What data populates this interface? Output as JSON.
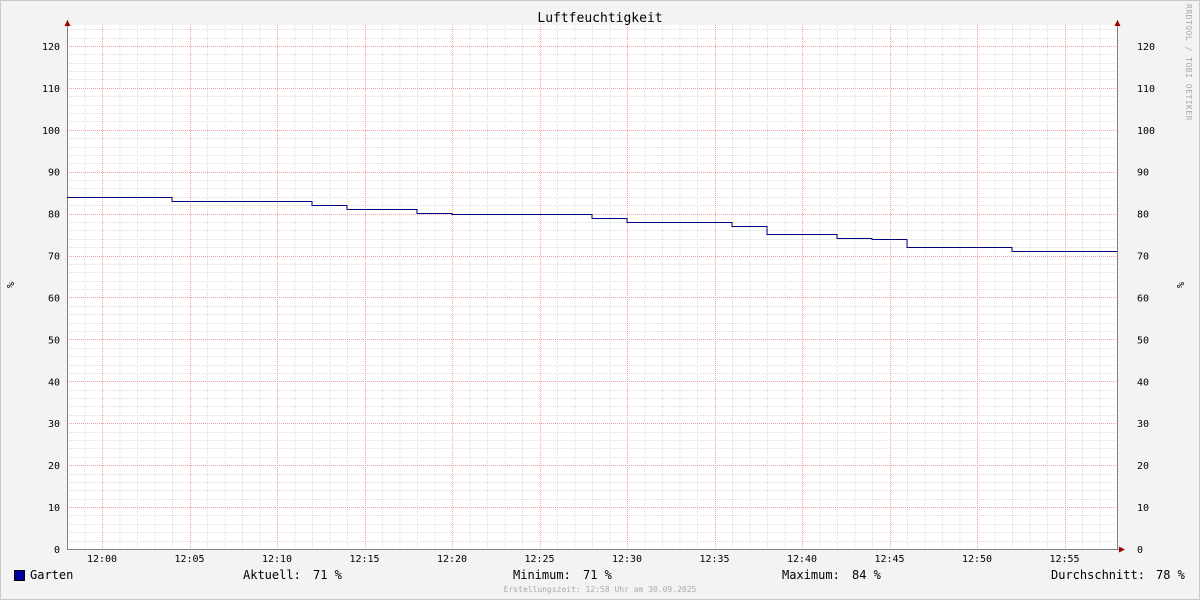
{
  "chart_data": {
    "type": "line",
    "title": "Luftfeuchtigkeit",
    "ylabel": "%",
    "ylim": [
      0,
      125
    ],
    "yticks": [
      0,
      10,
      20,
      30,
      40,
      50,
      60,
      70,
      80,
      90,
      100,
      110,
      120
    ],
    "xlim": [
      "11:58",
      "12:58"
    ],
    "xticks": [
      "12:00",
      "12:05",
      "12:10",
      "12:15",
      "12:20",
      "12:25",
      "12:30",
      "12:35",
      "12:40",
      "12:45",
      "12:50",
      "12:55"
    ],
    "grid": true,
    "series": [
      {
        "name": "Garten",
        "color": "#000080",
        "step": true,
        "x": [
          "11:58",
          "12:04",
          "12:12",
          "12:14",
          "12:18",
          "12:20",
          "12:28",
          "12:30",
          "12:36",
          "12:38",
          "12:42",
          "12:44",
          "12:46",
          "12:52"
        ],
        "y": [
          84,
          83,
          82,
          81,
          80.2,
          80,
          79,
          78,
          77,
          75.2,
          74.2,
          74,
          72,
          71
        ]
      }
    ]
  },
  "watermark": "RRDTOOL / TOBI OETIKER",
  "legend": {
    "series_name": "Garten",
    "swatch_color": "#0000a0",
    "current_label": "Aktuell:",
    "current_value": "71 %",
    "min_label": "Minimum:",
    "min_value": "71 %",
    "max_label": "Maximum:",
    "max_value": "84 %",
    "avg_label": "Durchschnitt:",
    "avg_value": "78 %"
  },
  "footer": "Erstellungszeit: 12:58 Uhr am 30.09.2025"
}
